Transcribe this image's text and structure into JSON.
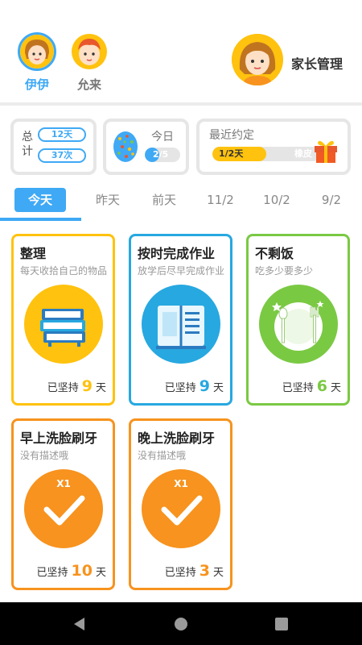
{
  "header": {
    "kids": [
      {
        "name": "伊伊",
        "selected": true
      },
      {
        "name": "允来",
        "selected": false
      }
    ],
    "parent_label": "家长管理"
  },
  "stats": {
    "total": {
      "label": "总计",
      "days": "12天",
      "times": "37次"
    },
    "today": {
      "label": "今日",
      "progress_text": "2/5",
      "done": 2,
      "total": 5
    },
    "promise": {
      "label": "最近约定",
      "days_text": "1/2天",
      "reward": "橡皮",
      "done": 1,
      "total": 2
    }
  },
  "tabs": [
    {
      "label": "今天",
      "active": true
    },
    {
      "label": "昨天",
      "active": false
    },
    {
      "label": "前天",
      "active": false
    },
    {
      "label": "11/2",
      "active": false
    },
    {
      "label": "10/2",
      "active": false
    },
    {
      "label": "9/2",
      "active": false
    }
  ],
  "streak_prefix": "已坚持",
  "streak_suffix": "天",
  "habits": [
    {
      "title": "整理",
      "desc": "每天收拾自己的物品",
      "days": "9",
      "color": "#ffc20e",
      "icon": "books-icon"
    },
    {
      "title": "按时完成作业",
      "desc": "放学后尽早完成作业",
      "days": "9",
      "color": "#27a8e0",
      "icon": "homework-book-icon"
    },
    {
      "title": "不剩饭",
      "desc": "吃多少要多少",
      "days": "6",
      "color": "#7ac943",
      "icon": "plate-icon"
    },
    {
      "title": "早上洗脸刷牙",
      "desc": "没有描述哦",
      "days": "10",
      "color": "#f7931e",
      "icon": "check-icon",
      "badge": "X1"
    },
    {
      "title": "晚上洗脸刷牙",
      "desc": "没有描述哦",
      "days": "3",
      "color": "#f7931e",
      "icon": "check-icon",
      "badge": "X1"
    }
  ],
  "colors": {
    "accent": "#3fa9f5",
    "yellow": "#ffc20e",
    "blue": "#27a8e0",
    "green": "#7ac943",
    "orange": "#f7931e"
  }
}
